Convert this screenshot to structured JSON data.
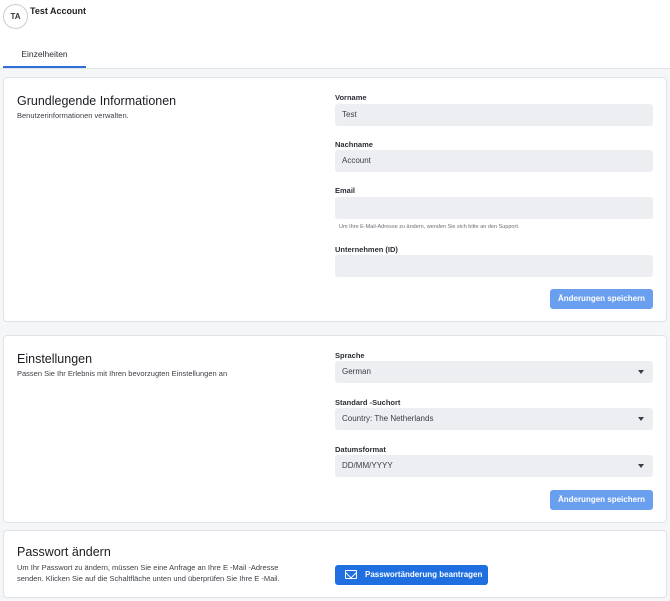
{
  "header": {
    "avatar_initials": "TA",
    "account_name": "Test Account",
    "account_sub": "·"
  },
  "tabs": [
    {
      "label": "Einzelheiten"
    }
  ],
  "basic": {
    "title": "Grundlegende Informationen",
    "description": "Benutzerinformationen verwalten.",
    "firstname_label": "Vorname",
    "firstname_value": "Test",
    "lastname_label": "Nachname",
    "lastname_value": "Account",
    "email_label": "Email",
    "email_value": "",
    "email_hint": "Um Ihre E-Mail-Adresse zu ändern, wenden Sie sich bitte an den Support.",
    "company_label": "Unternehmen (ID)",
    "company_value": "",
    "save_label": "Änderungen speichern"
  },
  "settings": {
    "title": "Einstellungen",
    "description": "Passen Sie Ihr Erlebnis mit Ihren bevorzugten Einstellungen an",
    "language_label": "Sprache",
    "language_value": "German",
    "location_label": "Standard -Suchort",
    "location_value": "Country: The Netherlands",
    "dateformat_label": "Datumsformat",
    "dateformat_value": "DD/MM/YYYY",
    "save_label": "Änderungen speichern"
  },
  "password": {
    "title": "Passwort ändern",
    "description_line1": "Um Ihr Passwort zu ändern, müssen Sie eine Anfrage an Ihre E -Mail -Adresse",
    "description_line2": "senden. Klicken Sie auf die Schaltfläche unten und überprüfen Sie Ihre E -Mail.",
    "button_label": "Passwortänderung beantragen",
    "button_icon": "mail-icon"
  },
  "colors": {
    "primary_button": "#6a9ff0",
    "dark_button": "#1f6fe0",
    "tab_underline": "#2f6fd6",
    "field_bg": "#eceef1"
  }
}
